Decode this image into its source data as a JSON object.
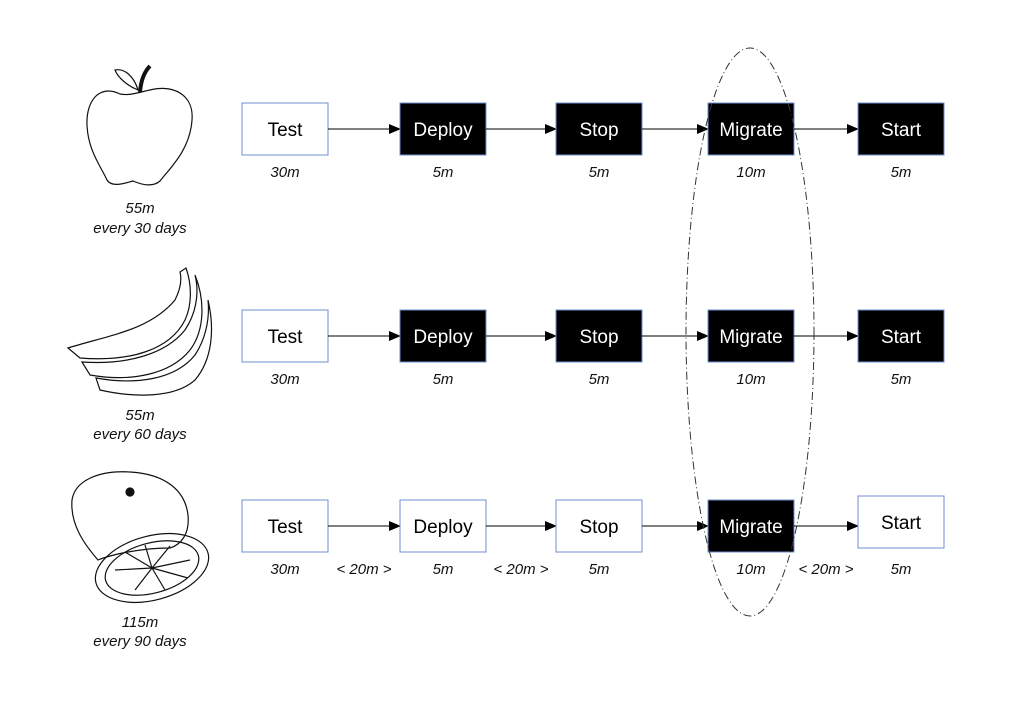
{
  "colors": {
    "box_border": "#6f8fcf",
    "dark_fill": "#000000",
    "light_fill": "#ffffff",
    "arrow": "#000000"
  },
  "rows": [
    {
      "fruit": "apple-icon",
      "total": "55m",
      "frequency": "every 30 days",
      "steps": [
        {
          "label": "Test",
          "duration": "30m",
          "dark": false
        },
        {
          "label": "Deploy",
          "duration": "5m",
          "dark": true
        },
        {
          "label": "Stop",
          "duration": "5m",
          "dark": true
        },
        {
          "label": "Migrate",
          "duration": "10m",
          "dark": true
        },
        {
          "label": "Start",
          "duration": "5m",
          "dark": true
        }
      ],
      "gaps": [
        "",
        "",
        "",
        ""
      ]
    },
    {
      "fruit": "banana-icon",
      "total": "55m",
      "frequency": "every 60 days",
      "steps": [
        {
          "label": "Test",
          "duration": "30m",
          "dark": false
        },
        {
          "label": "Deploy",
          "duration": "5m",
          "dark": true
        },
        {
          "label": "Stop",
          "duration": "5m",
          "dark": true
        },
        {
          "label": "Migrate",
          "duration": "10m",
          "dark": true
        },
        {
          "label": "Start",
          "duration": "5m",
          "dark": true
        }
      ],
      "gaps": [
        "",
        "",
        "",
        ""
      ]
    },
    {
      "fruit": "orange-icon",
      "total": "115m",
      "frequency": "every 90 days",
      "steps": [
        {
          "label": "Test",
          "duration": "30m",
          "dark": false
        },
        {
          "label": "Deploy",
          "duration": "5m",
          "dark": false
        },
        {
          "label": "Stop",
          "duration": "5m",
          "dark": false
        },
        {
          "label": "Migrate",
          "duration": "10m",
          "dark": true
        },
        {
          "label": "Start",
          "duration": "5m",
          "dark": false
        }
      ],
      "gaps": [
        "< 20m >",
        "< 20m >",
        "",
        "< 20m >"
      ]
    }
  ]
}
